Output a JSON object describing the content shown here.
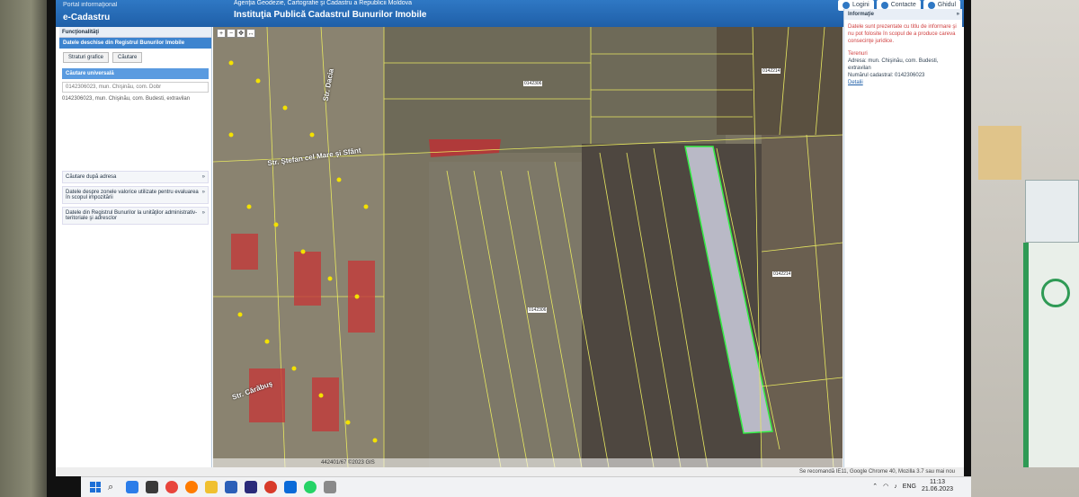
{
  "window": {
    "portal_label": "Portal informaţional",
    "app_title": "e-Cadastru",
    "agency": "Agenţia Geodezie, Cartografie şi Cadastru a Republicii Moldova",
    "institution": "Instituţia Publică Cadastrul Bunurilor Imobile",
    "buttons": [
      {
        "label": "Logini",
        "icon": "user-icon"
      },
      {
        "label": "Contacte",
        "icon": "skype-icon"
      },
      {
        "label": "Ghidul",
        "icon": "help-icon"
      }
    ]
  },
  "left_panel": {
    "header": "Funcţionalităţi",
    "section_title": "Datele deschise din Registrul Bunurilor Imobile",
    "tabs": [
      "Straturi grafice",
      "Căutare"
    ],
    "universal_search_title": "Căutare universală",
    "search_value": "0142306023, mun. Chişinău, com. Dobr",
    "search_result": "0142306023, mun. Chişinău, com. Budesti, extravilan",
    "sections": [
      "Căutare după adresa",
      "Datele despre zonele valorice utilizate pentru evaluarea în scopul impozitării",
      "Datele din Registrul Bunurilor la unităţilor administrativ-teritoriale şi adresclor"
    ]
  },
  "map": {
    "street_labels": [
      "Str. Ştefan cel Mare şi Sfânt",
      "Str. Dacia",
      "Str. Cărăbuş"
    ],
    "parcel_ids": [
      "0142214",
      "0142306",
      "0142214",
      "0142306"
    ],
    "copyright": "442401/67 ©2023 GIS"
  },
  "right_panel": {
    "header": "Informaţie",
    "disclaimer": "Datele sunt prezentate cu titlu de informare şi nu pot folosite în scopul de a produce careva consecinţe juridice.",
    "terenuri_label": "Terenuri",
    "address": "Adresa: mun. Chişinău, com. Budesti, extravilan",
    "cadastral": "Numărul cadastral: 0142306023",
    "details_link": "Detalii"
  },
  "status_bar": {
    "text": "Se recomandă IE11, Google Chrome 40, Mozilla 3.7 sau mai nou"
  },
  "taskbar": {
    "language": "ENG",
    "time": "11:13",
    "date": "21.06.2023"
  }
}
